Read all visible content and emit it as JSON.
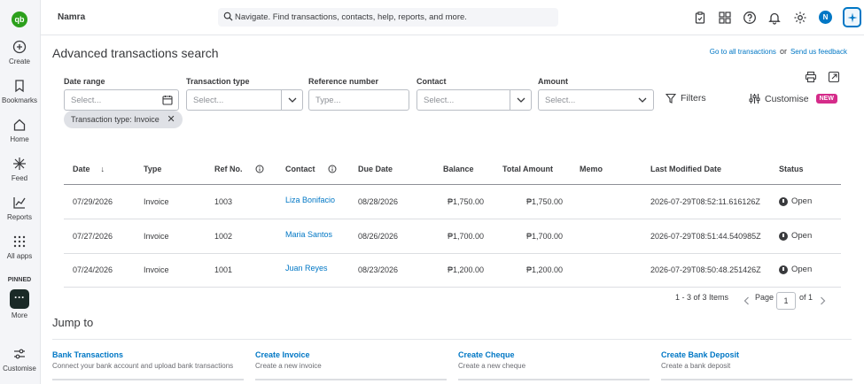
{
  "app": {
    "logo": "qb",
    "company": "Namra"
  },
  "search": {
    "placeholder": "Navigate. Find transactions, contacts, help, reports, and more."
  },
  "topbar_icons": [
    "clipboard-icon",
    "app-switch-icon",
    "help-icon",
    "bell-icon",
    "gear-icon"
  ],
  "avatar": "N",
  "sidebar": {
    "items": [
      {
        "label": "Create",
        "icon": "plus-circle-icon"
      },
      {
        "label": "Bookmarks",
        "icon": "bookmark-icon"
      },
      {
        "label": "Home",
        "icon": "home-icon"
      },
      {
        "label": "Feed",
        "icon": "sparkle-icon"
      },
      {
        "label": "Reports",
        "icon": "chart-icon"
      },
      {
        "label": "All apps",
        "icon": "grid-icon"
      }
    ],
    "pinned_label": "PINNED",
    "more_label": "More",
    "customise_label": "Customise"
  },
  "page": {
    "title": "Advanced transactions search",
    "link_all": "Go to all transactions",
    "or": "or",
    "link_feedback": "Send us feedback"
  },
  "filters": {
    "date_range": {
      "label": "Date range",
      "placeholder": "Select..."
    },
    "transaction_type": {
      "label": "Transaction type",
      "placeholder": "Select..."
    },
    "reference_number": {
      "label": "Reference number",
      "placeholder": "Type..."
    },
    "contact": {
      "label": "Contact",
      "placeholder": "Select..."
    },
    "amount": {
      "label": "Amount",
      "placeholder": "Select..."
    },
    "filters_label": "Filters",
    "customise_label": "Customise",
    "new_badge": "NEW",
    "chip": "Transaction type: Invoice"
  },
  "table": {
    "columns": [
      "Date",
      "Type",
      "Ref No.",
      "Contact",
      "Due Date",
      "Balance",
      "Total Amount",
      "Memo",
      "Last Modified Date",
      "Status"
    ],
    "rows": [
      {
        "date": "07/29/2026",
        "type": "Invoice",
        "ref": "1003",
        "contact": "Liza Bonifacio",
        "due": "08/28/2026",
        "balance": "₱1,750.00",
        "total": "₱1,750.00",
        "memo": "",
        "modified": "2026-07-29T08:52:11.616126Z",
        "status": "Open"
      },
      {
        "date": "07/27/2026",
        "type": "Invoice",
        "ref": "1002",
        "contact": "Maria Santos",
        "due": "08/26/2026",
        "balance": "₱1,700.00",
        "total": "₱1,700.00",
        "memo": "",
        "modified": "2026-07-29T08:51:44.540985Z",
        "status": "Open"
      },
      {
        "date": "07/24/2026",
        "type": "Invoice",
        "ref": "1001",
        "contact": "Juan Reyes",
        "due": "08/23/2026",
        "balance": "₱1,200.00",
        "total": "₱1,200.00",
        "memo": "",
        "modified": "2026-07-29T08:50:48.251426Z",
        "status": "Open"
      }
    ]
  },
  "pagination": {
    "summary": "1 - 3 of 3 Items",
    "page_label": "Page",
    "page": "1",
    "of": "of 1"
  },
  "jump_to": {
    "title": "Jump to",
    "cards": [
      {
        "title": "Bank Transactions",
        "subtitle": "Connect your bank account and upload bank transactions"
      },
      {
        "title": "Create Invoice",
        "subtitle": "Create a new invoice"
      },
      {
        "title": "Create Cheque",
        "subtitle": "Create a new cheque"
      },
      {
        "title": "Create Bank Deposit",
        "subtitle": "Create a bank deposit"
      }
    ]
  }
}
